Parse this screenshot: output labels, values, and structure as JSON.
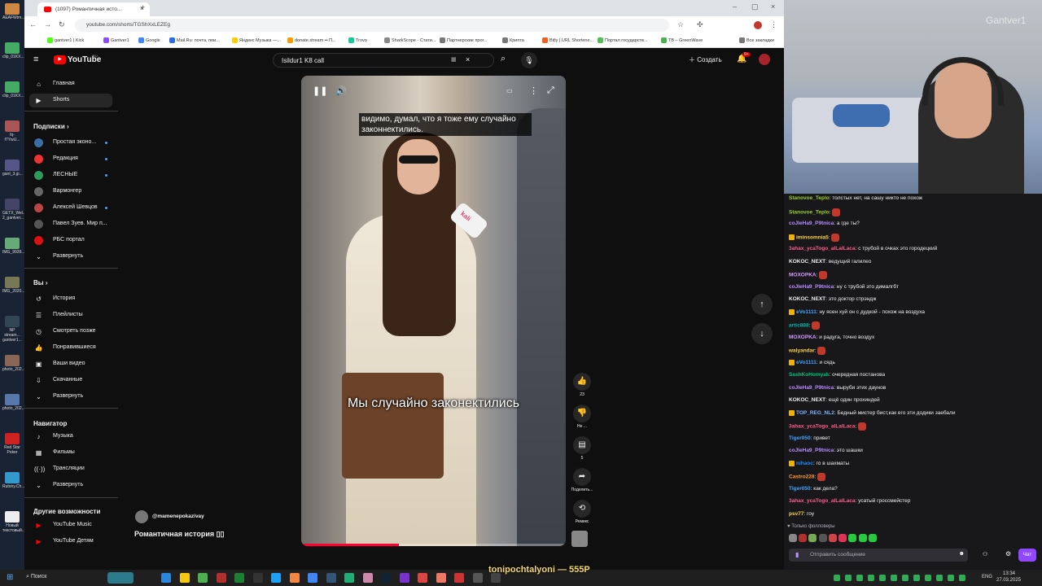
{
  "desktop": {
    "icons": [
      "AEAFWtm...",
      "clip_01KX...",
      "clip_01KX...",
      "fq-f7YwU...",
      "gant_3.gi...",
      "GETX_Wel... 2_gantver...",
      "IMG_9939...",
      "IMG_2020...",
      "NP stream... gantver1...",
      "photo_202...",
      "photo_202...",
      "Red Star Poker",
      "Rutony.Ch...",
      "Новый текстовый..."
    ]
  },
  "browser": {
    "tab_title": "(1097) Романтичная исто...",
    "url": "youtube.com/shorts/TGShXxLEZEg",
    "bookmarks": [
      "gantver1 | Kick",
      "Gantver1",
      "Google",
      "Mail.Ru: почта, пои...",
      "Яндекс Музыка —...",
      "donate.stream •• П...",
      "Trovo",
      "SharkScope - Стати...",
      "Партнерские прог...",
      "Крипта",
      "Bitly | URL Shortene...",
      "Портал государств...",
      "TB – GreenWave",
      "Все закладки"
    ]
  },
  "youtube": {
    "logo": "YouTube",
    "logo_sup": "RU",
    "search_value": "Isildur1 K8 call",
    "create_label": "Создать",
    "notif_count": "9+",
    "sidebar": {
      "main": [
        {
          "label": "Главная",
          "icon": "home-icon"
        },
        {
          "label": "Shorts",
          "icon": "shorts-icon"
        }
      ],
      "subs_header": "Подписки",
      "subs": [
        "Простая эконо...",
        "Редакция",
        "ЛЕСНЫЕ",
        "Вармонгер",
        "Алексей Шевцов",
        "Павел Зуев. Мир п...",
        "РБС портал"
      ],
      "expand": "Развернуть",
      "you_header": "Вы",
      "you": [
        "История",
        "Плейлисты",
        "Смотреть позже",
        "Понравившиеся",
        "Ваши видео",
        "Скачанные",
        "Развернуть"
      ],
      "nav_header": "Навигатор",
      "nav": [
        "Музыка",
        "Фильмы",
        "Трансляции",
        "Развернуть"
      ],
      "other_header": "Другие возможности",
      "other": [
        "YouTube Music",
        "YouTube Детям"
      ]
    },
    "video": {
      "subtitle_top": "видимо, думал, что я тоже ему случайно законнектились.",
      "subtitle_main": "Мы случайно законектились",
      "progress": 0.37,
      "mic_brand": "kali"
    },
    "channel": "@mamenepokazivay",
    "video_title": "Романтичная история ▯▯",
    "actions": {
      "likes": "23",
      "dislike": "Не ...",
      "comments": "5",
      "share": "Поделить...",
      "remix": "Ремикс"
    }
  },
  "webcam": {
    "watermark": "Gantver1"
  },
  "chat": {
    "messages": [
      {
        "user": "Stanovoe_Teplo",
        "color": "#9acd32",
        "text": "толстых нет, на сашу никто не похож"
      },
      {
        "user": "Stanovoe_Teplo",
        "color": "#9acd32",
        "text": ""
      },
      {
        "user": "coJleHa9_P9tnica",
        "color": "#b98cff",
        "text": "а где ты?"
      },
      {
        "user": "iminsomnia5",
        "color": "#ffd24a",
        "text": ""
      },
      {
        "user": "3ahax_ycaTogo_aILaILaca",
        "color": "#ff5c8a",
        "text": "с трубой в очках это городецкий"
      },
      {
        "user": "KOKOC_NEXT",
        "color": "#efeff1",
        "text": "ведущий галилео"
      },
      {
        "user": "MOXOPKA",
        "color": "#d59cff",
        "text": ""
      },
      {
        "user": "coJleHa9_P9tnica",
        "color": "#b98cff",
        "text": "ну с трубой это дималгбт"
      },
      {
        "user": "KOKOC_NEXT",
        "color": "#efeff1",
        "text": "это доктор стрэндж"
      },
      {
        "user": "eVo1111",
        "color": "#3ea6ff",
        "text": "ну ясен хуй он с дудкой - похож на воздуха"
      },
      {
        "user": "artic888",
        "color": "#00b5ad",
        "text": ""
      },
      {
        "user": "MOXOPKA",
        "color": "#d59cff",
        "text": "и радуга, точно воздух"
      },
      {
        "user": "walyandar",
        "color": "#ffd24a",
        "text": ""
      },
      {
        "user": "eVo1111",
        "color": "#3ea6ff",
        "text": "и сядь"
      },
      {
        "user": "SashKoHomyak",
        "color": "#00c27a",
        "text": "очередная постанова"
      },
      {
        "user": "coJleHa9_P9tnica",
        "color": "#b98cff",
        "text": "выруби этих даунов"
      },
      {
        "user": "KOKOC_NEXT",
        "color": "#efeff1",
        "text": "ещё один прохиндей"
      },
      {
        "user": "TOP_REG_NL2",
        "color": "#7fb2ff",
        "text": "Бедный мистер бист,как его эти додики заебали"
      },
      {
        "user": "3ahax_ycaTogo_aILaILaca",
        "color": "#ff5c8a",
        "text": ""
      },
      {
        "user": "Tiger050",
        "color": "#3ea6ff",
        "text": "привет"
      },
      {
        "user": "coJleHa9_P9tnica",
        "color": "#b98cff",
        "text": "это шашки"
      },
      {
        "user": "nihaoc",
        "color": "#1e90ff",
        "text": "го в шахматы"
      },
      {
        "user": "Castro228",
        "color": "#ff9a3c",
        "text": ""
      },
      {
        "user": "Tiger050",
        "color": "#3ea6ff",
        "text": "как дела?"
      },
      {
        "user": "3ahax_ycaTogo_aILaILaca",
        "color": "#ff5c8a",
        "text": "усатый гроссмейстер"
      },
      {
        "user": "psv77",
        "color": "#ffd24a",
        "text": "гоу"
      }
    ],
    "followers_label": "Только фолловеры",
    "input_placeholder": "Отправить сообщение",
    "send_label": "Чат"
  },
  "taskbar": {
    "search_label": "Поиск",
    "overlay": "tonipochtalyoni — 555P",
    "lang": "ENG",
    "time": "13:34",
    "date": "27.03.2025"
  }
}
